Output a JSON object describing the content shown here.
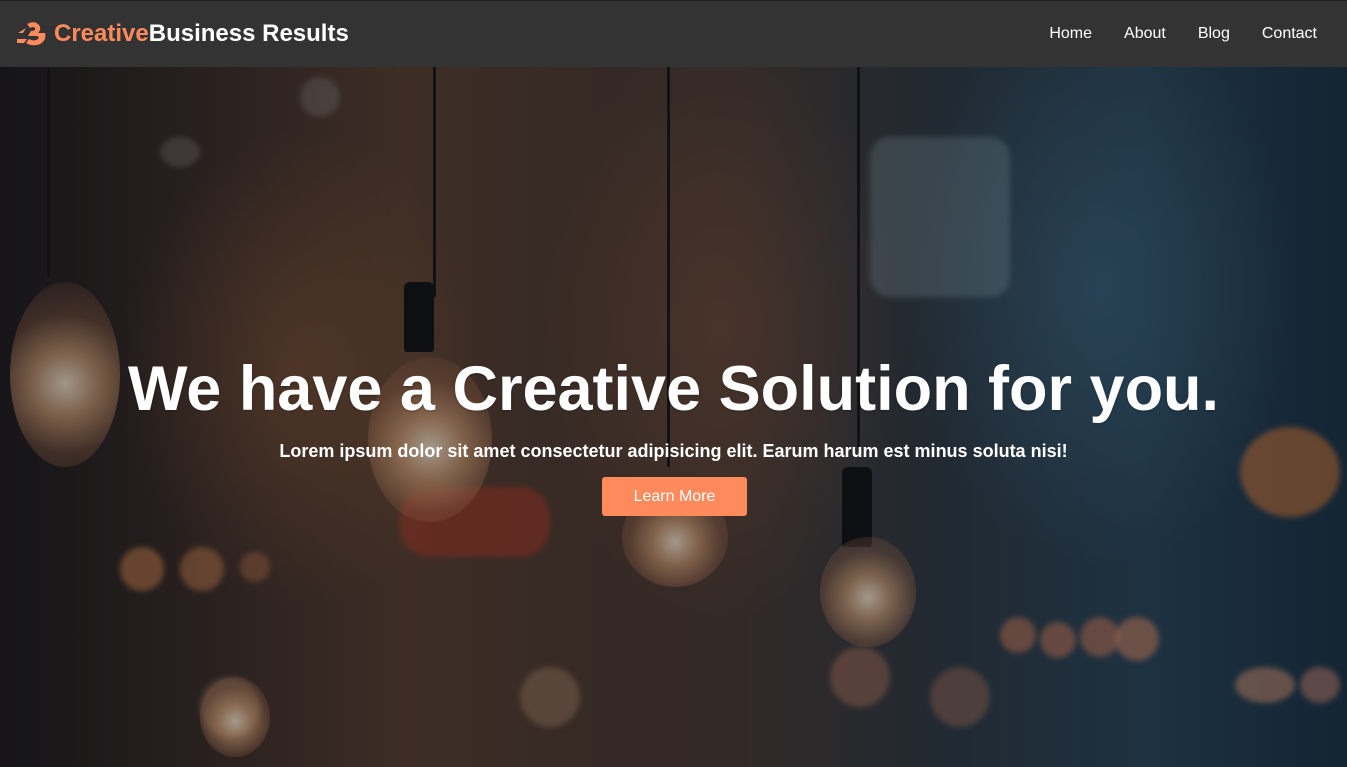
{
  "brand": {
    "accent_text": "Creative",
    "rest_text": "Business Results",
    "accent_color": "#ff8a5c",
    "icon": "brand-logo-icon"
  },
  "nav": {
    "items": [
      {
        "label": "Home"
      },
      {
        "label": "About"
      },
      {
        "label": "Blog"
      },
      {
        "label": "Contact"
      }
    ]
  },
  "hero": {
    "title": "We have a Creative Solution for you.",
    "subtitle": "Lorem ipsum dolor sit amet consectetur adipisicing elit. Earum harum est minus soluta nisi!",
    "cta_label": "Learn More",
    "background": "hanging-light-bulbs-photo"
  },
  "colors": {
    "navbar_bg": "#333333",
    "accent": "#ff8a5c",
    "text": "#ffffff"
  }
}
